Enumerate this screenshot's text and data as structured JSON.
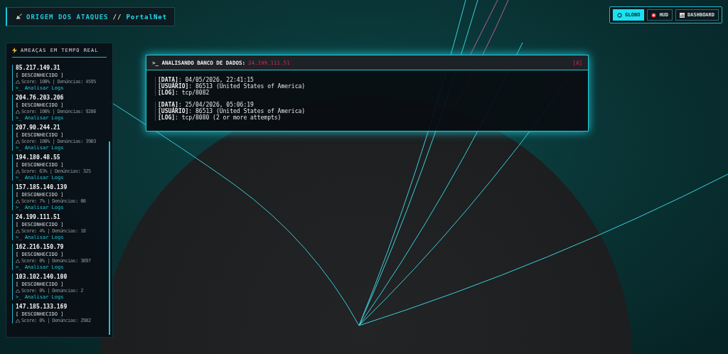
{
  "header": {
    "title": "ORIGEM DOS ATAQUES",
    "separator": "//",
    "brand": "PortalNet"
  },
  "nav": [
    {
      "label": "GLOBO",
      "kind": "globe",
      "selected": true
    },
    {
      "label": "HUD",
      "kind": "target",
      "selected": false
    },
    {
      "label": "DASHBOARD",
      "kind": "chart",
      "selected": false
    }
  ],
  "sidebar": {
    "title": "AMEAÇAS EM TEMPO REAL",
    "items": [
      {
        "ip": "85.217.149.31",
        "status": "[ DESCONHECIDO ]",
        "score": "Score: 100% | Denúncias: 4595",
        "link": ">_ Analisar Logs"
      },
      {
        "ip": "204.76.203.206",
        "status": "[ DESCONHECIDO ]",
        "score": "Score: 100% | Denúncias: 9286",
        "link": ">_ Analisar Logs"
      },
      {
        "ip": "207.90.244.21",
        "status": "[ DESCONHECIDO ]",
        "score": "Score: 100% | Denúncias: 3903",
        "link": ">_ Analisar Logs"
      },
      {
        "ip": "194.180.48.55",
        "status": "[ DESCONHECIDO ]",
        "score": "Score: 63% | Denúncias: 325",
        "link": ">_ Analisar Logs"
      },
      {
        "ip": "157.185.140.139",
        "status": "[ DESCONHECIDO ]",
        "score": "Score: 7% | Denúncias: 08",
        "link": ">_ Analisar Logs"
      },
      {
        "ip": "24.199.111.51",
        "status": "[ DESCONHECIDO ]",
        "score": "Score: 4% | Denúncias: 18",
        "link": ">_ Analisar Logs"
      },
      {
        "ip": "162.216.150.79",
        "status": "[ DESCONHECIDO ]",
        "score": "Score: 0% | Denúncias: 3897",
        "link": ">_ Analisar Logs"
      },
      {
        "ip": "103.102.140.100",
        "status": "[ DESCONHECIDO ]",
        "score": "Score: 0% | Denúncias: 2",
        "link": ">_ Analisar Logs"
      },
      {
        "ip": "147.185.133.169",
        "status": "[ DESCONHECIDO ]",
        "score": "Score: 0% | Denúncias: 2982"
      }
    ]
  },
  "modal": {
    "title": ">_ ANALISANDO BANCO DE DADOS:",
    "ip": "24.199.111.51",
    "close": "[X]",
    "entries": [
      {
        "lines": [
          {
            "label": "[DATA]",
            "value": ": 04/05/2026, 22:41:15"
          },
          {
            "label": "[USUÁRIO]",
            "value": ": 86513 (United States of America)"
          },
          {
            "label": "[LOG]",
            "value": ": tcp/8082"
          }
        ]
      },
      {
        "lines": [
          {
            "label": "[DATA]",
            "value": ": 25/04/2026, 05:06:19"
          },
          {
            "label": "[USUÁRIO]",
            "value": ": 86513 (United States of America)"
          },
          {
            "label": "[LOG]",
            "value": ": tcp/8080 (2 or more attempts)"
          }
        ]
      }
    ]
  }
}
